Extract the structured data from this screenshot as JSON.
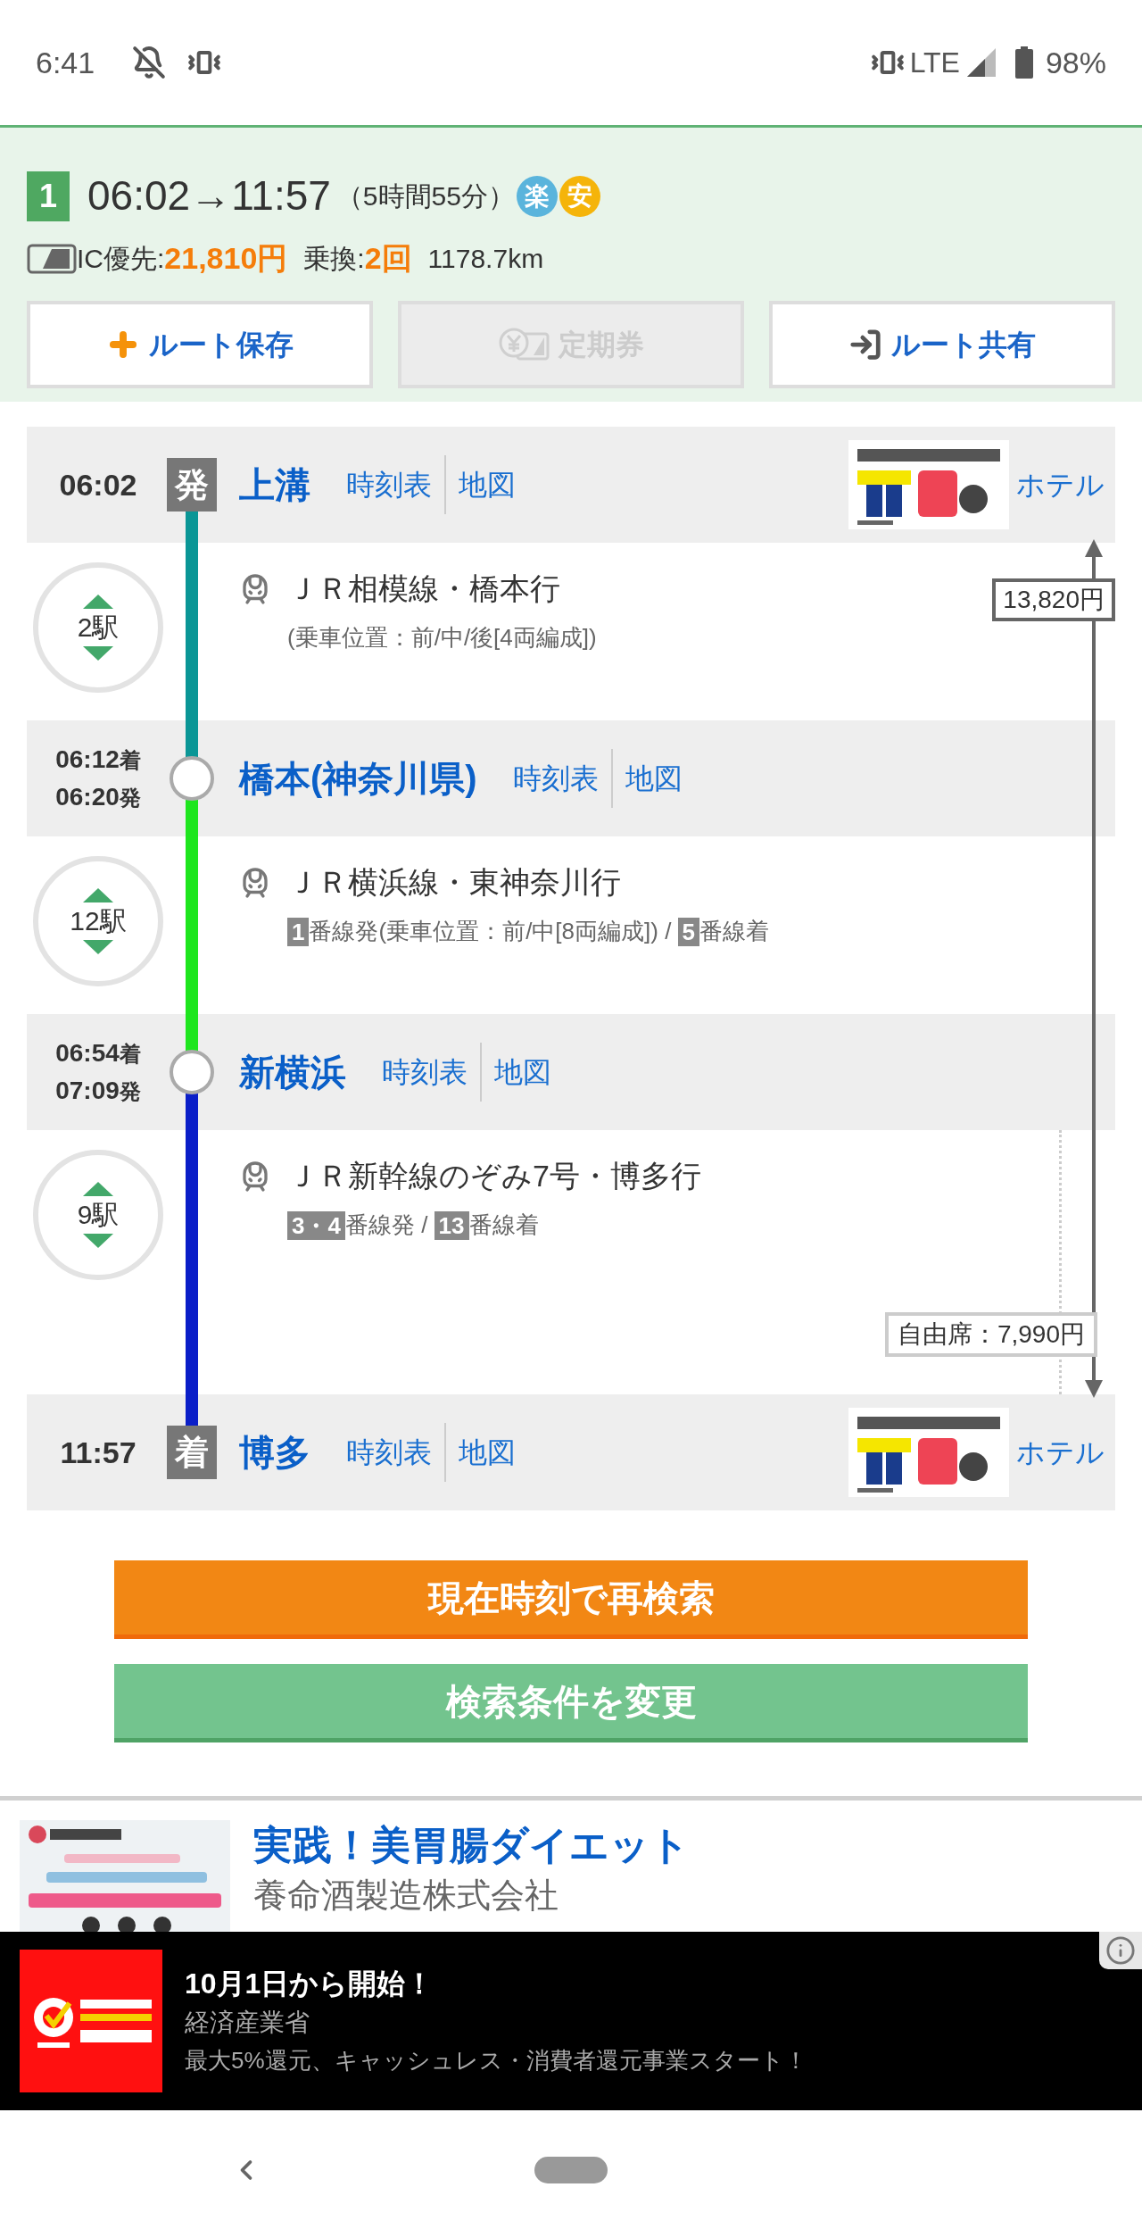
{
  "status_bar": {
    "time": "6:41",
    "network": "LTE",
    "battery": "98%"
  },
  "route": {
    "number": "1",
    "departure": "06:02",
    "arrow": "→",
    "arrival": "11:57",
    "duration": "（5時間55分）",
    "badges": [
      {
        "label": "楽",
        "color": "#5ab4dc"
      },
      {
        "label": "安",
        "color": "#f5b40a"
      }
    ],
    "fare_label": "IC優先:",
    "fare": "21,810円",
    "transfer_label": "乗換:",
    "transfers": "2回",
    "distance": "1178.7km",
    "buttons": [
      {
        "label": "ルート保存",
        "kind": "save",
        "disabled": false
      },
      {
        "label": "定期券",
        "kind": "pass",
        "disabled": true
      },
      {
        "label": "ルート共有",
        "kind": "share",
        "disabled": false
      }
    ]
  },
  "timeline": {
    "through_fare": "13,820円",
    "items": [
      {
        "kind": "station",
        "mark": "発",
        "times": [
          {
            "time": "06:02"
          }
        ],
        "name": "上溝",
        "links": [
          "時刻表",
          "地図"
        ],
        "hotel": "ホテル"
      },
      {
        "kind": "segment",
        "color": "#0a9696",
        "stops": "2駅",
        "line": "ＪＲ相模線・橋本行",
        "details": [
          {
            "kind": "text",
            "text": "(乗車位置：前/中/後[4両編成])"
          }
        ]
      },
      {
        "kind": "station",
        "times": [
          {
            "time": "06:12",
            "suffix": "着"
          },
          {
            "time": "06:20",
            "suffix": "発"
          }
        ],
        "name": "橋本(神奈川県)",
        "links": [
          "時刻表",
          "地図"
        ]
      },
      {
        "kind": "segment",
        "color": "#1ee61e",
        "stops": "12駅",
        "line": "ＪＲ横浜線・東神奈川行",
        "details": [
          {
            "kind": "badge",
            "text": "1"
          },
          {
            "kind": "text",
            "text": "番線発(乗車位置：前/中[8両編成]) / "
          },
          {
            "kind": "badge",
            "text": "5"
          },
          {
            "kind": "text",
            "text": "番線着"
          }
        ]
      },
      {
        "kind": "station",
        "times": [
          {
            "time": "06:54",
            "suffix": "着"
          },
          {
            "time": "07:09",
            "suffix": "発"
          }
        ],
        "name": "新横浜",
        "links": [
          "時刻表",
          "地図"
        ]
      },
      {
        "kind": "segment",
        "color": "#0a1ec8",
        "stops": "9駅",
        "line": "ＪＲ新幹線のぞみ7号・博多行",
        "details": [
          {
            "kind": "badge",
            "text": "3・4"
          },
          {
            "kind": "text",
            "text": "番線発 / "
          },
          {
            "kind": "badge",
            "text": "13"
          },
          {
            "kind": "text",
            "text": "番線着"
          }
        ],
        "fare": "自由席：7,990円"
      },
      {
        "kind": "station",
        "mark": "着",
        "times": [
          {
            "time": "11:57"
          }
        ],
        "name": "博多",
        "links": [
          "時刻表",
          "地図"
        ],
        "hotel": "ホテル"
      }
    ]
  },
  "actions": [
    {
      "label": "現在時刻で再検索",
      "kind": "primary"
    },
    {
      "label": "検索条件を変更",
      "kind": "secondary"
    }
  ],
  "ad": {
    "title": "実践！美胃腸ダイエット",
    "sponsor": "養命酒製造株式会社"
  },
  "banner": {
    "title": "10月1日から開始！",
    "advertiser": "経済産業省",
    "text": "最大5%還元、キャッシュレス・消費者還元事業スタート！"
  }
}
